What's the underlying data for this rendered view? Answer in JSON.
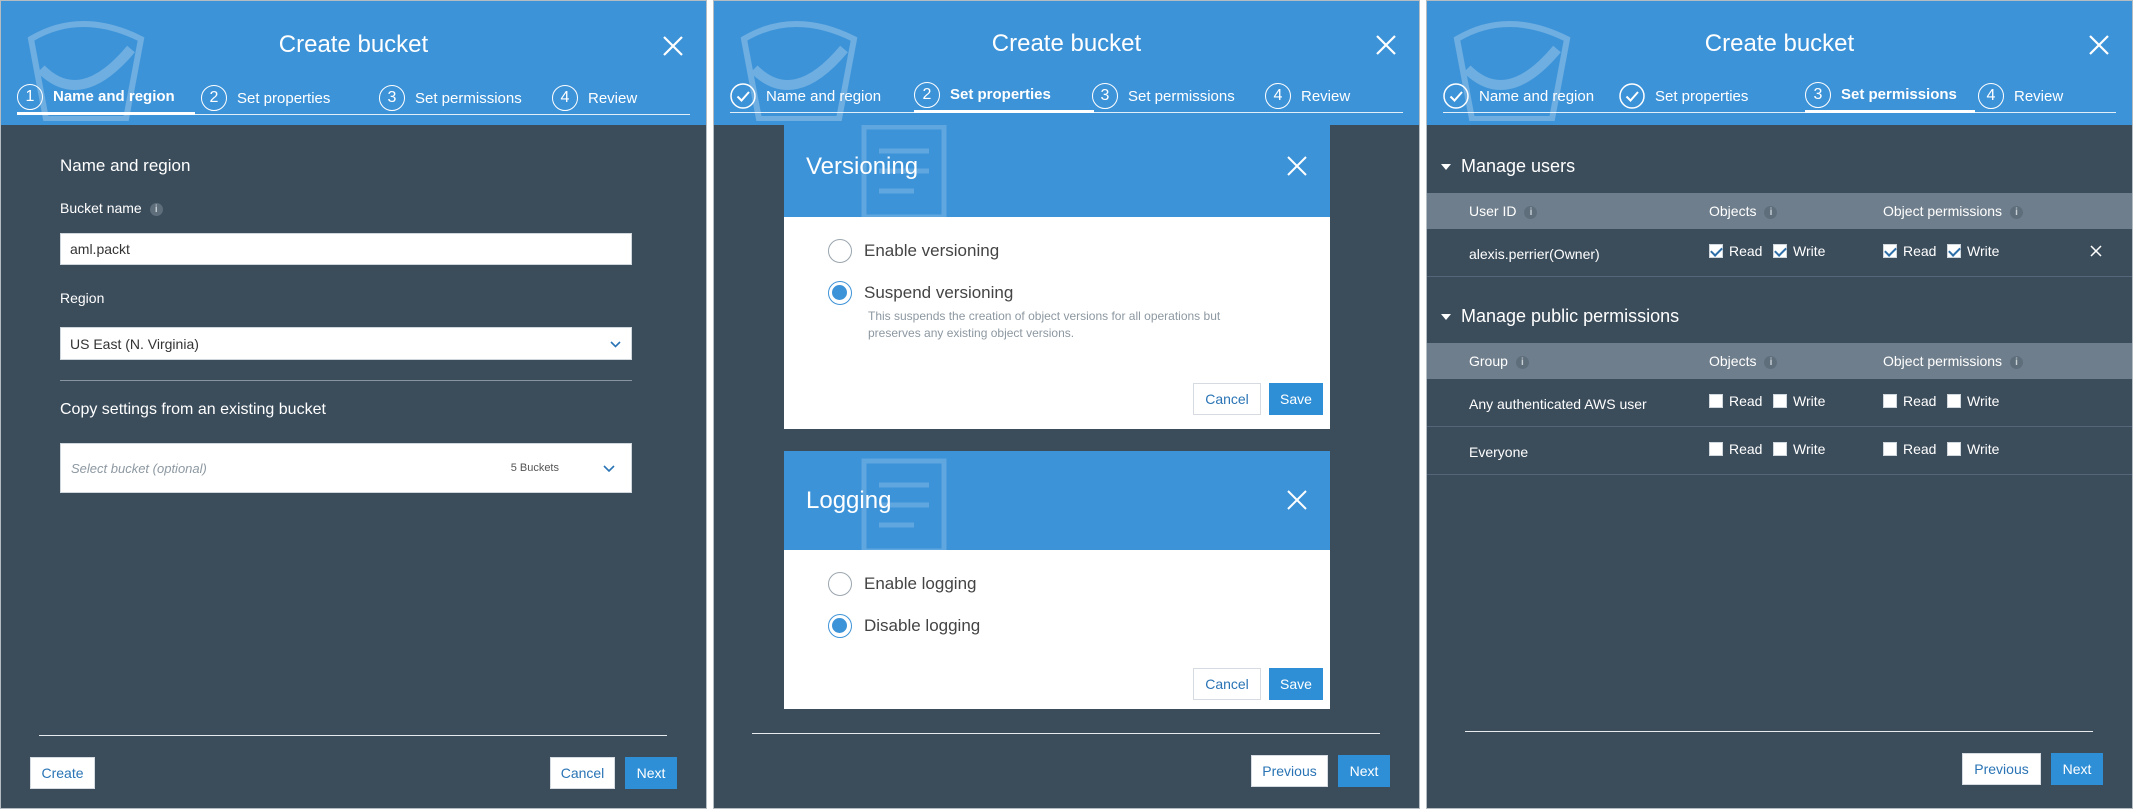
{
  "colors": {
    "header_blue": "#3d93d8",
    "panel_bg": "#3b4c5b",
    "button_blue": "#2f8fd6",
    "table_header": "#6f7e8c"
  },
  "dialog_title": "Create bucket",
  "steps": [
    {
      "num": "1",
      "label": "Name and region"
    },
    {
      "num": "2",
      "label": "Set properties"
    },
    {
      "num": "3",
      "label": "Set permissions"
    },
    {
      "num": "4",
      "label": "Review"
    }
  ],
  "name_region": {
    "section_title": "Name and region",
    "bucket_name_label": "Bucket name",
    "bucket_name_value": "aml.packt",
    "region_label": "Region",
    "region_value": "US East (N. Virginia)",
    "copy_title": "Copy settings from an existing bucket",
    "select_placeholder": "Select bucket (optional)",
    "bucket_count": "5 Buckets"
  },
  "properties": {
    "versioning": {
      "title": "Versioning",
      "option_enable": "Enable versioning",
      "option_suspend": "Suspend versioning",
      "selected": "suspend",
      "suspend_desc_line1": "This suspends the creation of object versions for all operations but",
      "suspend_desc_line2": "preserves any existing object versions."
    },
    "logging": {
      "title": "Logging",
      "option_enable": "Enable logging",
      "option_disable": "Disable logging",
      "selected": "disable"
    }
  },
  "permissions": {
    "manage_users": "Manage users",
    "manage_public": "Manage public permissions",
    "col_user_id": "User ID",
    "col_group": "Group",
    "col_objects": "Objects",
    "col_object_permissions": "Object permissions",
    "read": "Read",
    "write": "Write",
    "owner_row": {
      "user": "alexis.perrier(Owner)",
      "objects_read": true,
      "objects_write": true,
      "perm_read": true,
      "perm_write": true
    },
    "group_rows": [
      {
        "group": "Any authenticated AWS user",
        "objects_read": false,
        "objects_write": false,
        "perm_read": false,
        "perm_write": false
      },
      {
        "group": "Everyone",
        "objects_read": false,
        "objects_write": false,
        "perm_read": false,
        "perm_write": false
      }
    ]
  },
  "buttons": {
    "create": "Create",
    "cancel": "Cancel",
    "next": "Next",
    "previous": "Previous",
    "save": "Save"
  }
}
